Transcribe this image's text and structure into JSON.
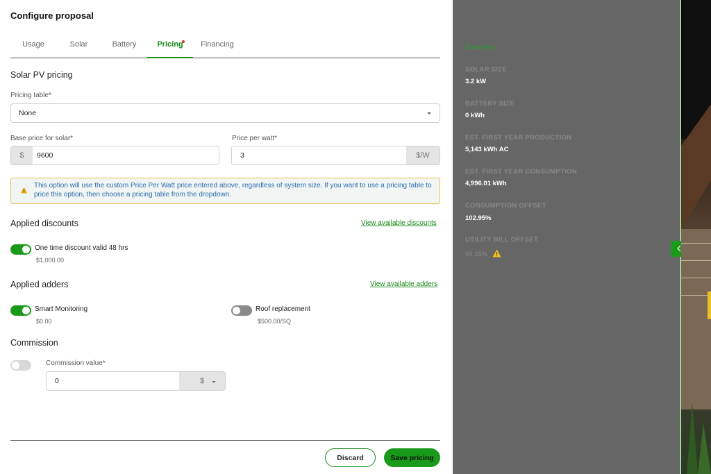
{
  "header": {
    "title": "Configure proposal"
  },
  "tabs": [
    {
      "label": "Usage",
      "active": false
    },
    {
      "label": "Solar",
      "active": false
    },
    {
      "label": "Battery",
      "active": false
    },
    {
      "label": "Pricing",
      "active": true,
      "has_dot": true
    },
    {
      "label": "Financing",
      "active": false
    }
  ],
  "solar_pricing": {
    "heading": "Solar PV pricing",
    "pricing_table_label": "Pricing table*",
    "pricing_table_value": "None",
    "base_price_label": "Base price for solar*",
    "base_price_prefix": "$",
    "base_price_value": "9600",
    "ppw_label": "Price per watt*",
    "ppw_value": "3",
    "ppw_suffix": "$/W",
    "warning": "This option will use the custom Price Per Watt price entered above, regardless of system size. If you want to use a pricing table to price this option, then choose a pricing table from the dropdown."
  },
  "discounts": {
    "heading": "Applied discounts",
    "link": "View available discounts",
    "items": [
      {
        "name": "One time discount valid 48 hrs",
        "price": "$1,000.00",
        "enabled": true
      }
    ]
  },
  "adders": {
    "heading": "Applied adders",
    "link": "View available adders",
    "items": [
      {
        "name": "Smart Monitoring",
        "price": "$0.00",
        "enabled": true
      },
      {
        "name": "Roof replacement",
        "price": "$500.00/SQ",
        "enabled": false
      }
    ]
  },
  "commission": {
    "heading": "Commission",
    "value_label": "Commission value*",
    "value": "0",
    "unit": "$"
  },
  "footer": {
    "discard_label": "Discard",
    "save_label": "Save pricing"
  },
  "summary": {
    "title": "Summary",
    "metrics": [
      {
        "label": "SOLAR SIZE",
        "value": "3.2 kW"
      },
      {
        "label": "BATTERY SIZE",
        "value": "0 kWh"
      },
      {
        "label": "EST. FIRST YEAR PRODUCTION",
        "value": "5,143 kWh AC"
      },
      {
        "label": "EST. FIRST YEAR CONSUMPTION",
        "value": "4,996.01 kWh"
      },
      {
        "label": "CONSUMPTION OFFSET",
        "value": "102.95%"
      },
      {
        "label": "UTILITY BILL OFFSET",
        "value": "69.15%"
      }
    ]
  },
  "colors": {
    "accent": "#1a9a1a",
    "warning_border": "#e9c24c",
    "panel": "#666666",
    "link": "#1a8a1a"
  },
  "icons": [
    "warning-icon",
    "chevron-down-icon",
    "chevron-left-icon"
  ]
}
